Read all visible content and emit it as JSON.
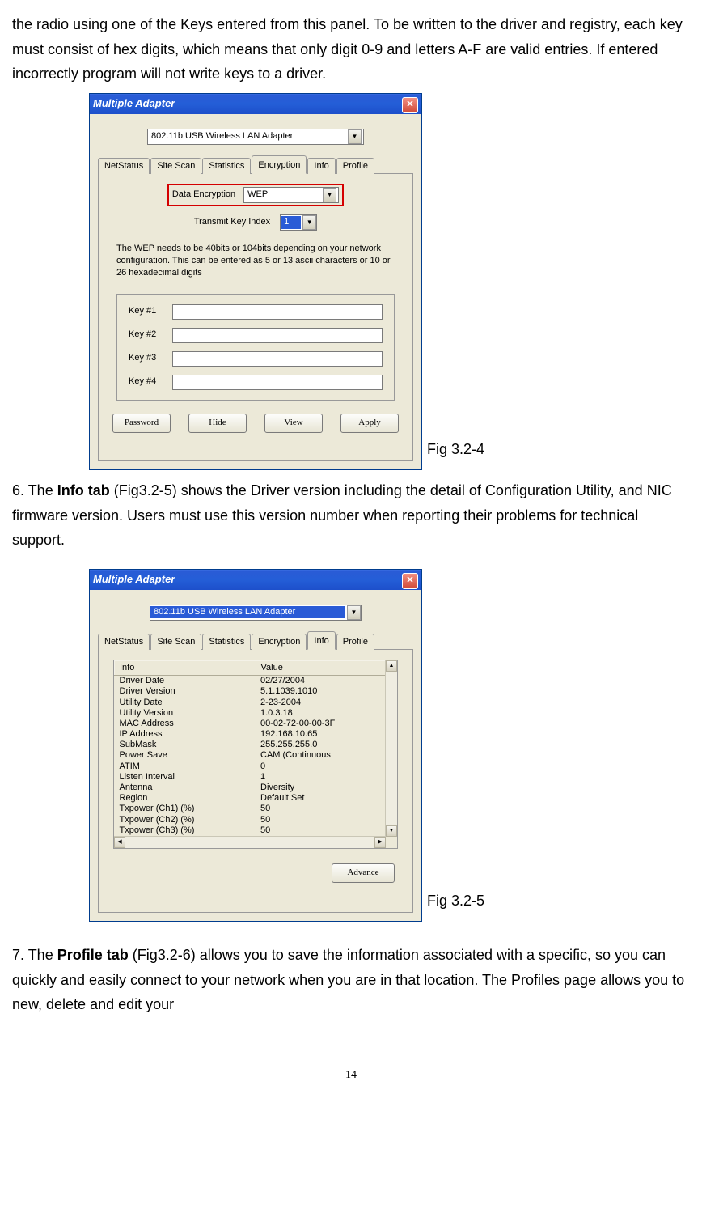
{
  "doc": {
    "para_top": "the radio using one of the Keys entered from this panel. To be written to the driver and registry, each key must consist of hex digits, which means that only digit 0-9 and letters A-F are valid entries. If entered incorrectly program will not write keys to a driver.",
    "fig1_caption": " Fig 3.2-4",
    "para_info_prefix": "6. The ",
    "para_info_bold": "Info tab",
    "para_info_rest": " (Fig3.2-5) shows the Driver version including the detail of Configuration Utility, and NIC firmware version. Users must use this version number when reporting their problems for technical support.",
    "fig2_caption": "Fig 3.2-5",
    "para_profile_prefix": "7. The ",
    "para_profile_bold": "Profile tab",
    "para_profile_rest": " (Fig3.2-6) allows you to save the information associated with a specific, so you can quickly and easily connect to your network when you are in that location. The Profiles page allows you to new, delete and edit your",
    "page_number": "14"
  },
  "dialog_common": {
    "title": "Multiple Adapter",
    "close_glyph": "✕",
    "adapter_text": "802.11b USB Wireless LAN Adapter",
    "tabs": {
      "netstatus": "NetStatus",
      "sitescan": "Site Scan",
      "statistics": "Statistics",
      "encryption": "Encryption",
      "info": "Info",
      "profile": "Profile"
    },
    "combo_arrow": "▼"
  },
  "enc": {
    "data_encryption_label": "Data Encryption",
    "wep_value": "WEP",
    "transmit_key_label": "Transmit Key Index",
    "transmit_key_value": "1",
    "note": "The WEP needs to be 40bits or 104bits depending on your network configuration. This can be entered as 5 or 13 ascii characters or 10 or 26 hexadecimal digits",
    "key1": "Key #1",
    "key2": "Key #2",
    "key3": "Key #3",
    "key4": "Key #4",
    "btn_password": "Password",
    "btn_hide": "Hide",
    "btn_view": "View",
    "btn_apply": "Apply"
  },
  "info": {
    "col_info": "Info",
    "col_value": "Value",
    "rows": [
      {
        "k": "Driver Date",
        "v": "02/27/2004"
      },
      {
        "k": "Driver Version",
        "v": "5.1.1039.1010"
      },
      {
        "k": "Utility Date",
        "v": "2-23-2004"
      },
      {
        "k": "Utility Version",
        "v": "1.0.3.18"
      },
      {
        "k": "MAC Address",
        "v": "00-02-72-00-00-3F"
      },
      {
        "k": "IP Address",
        "v": "192.168.10.65"
      },
      {
        "k": "SubMask",
        "v": "255.255.255.0"
      },
      {
        "k": "Power Save",
        "v": "CAM (Continuous"
      },
      {
        "k": "ATIM",
        "v": "0"
      },
      {
        "k": "Listen Interval",
        "v": "1"
      },
      {
        "k": "Antenna",
        "v": "Diversity"
      },
      {
        "k": "Region",
        "v": "Default Set"
      },
      {
        "k": "Txpower (Ch1) (%)",
        "v": "50"
      },
      {
        "k": "Txpower (Ch2) (%)",
        "v": "50"
      },
      {
        "k": "Txpower (Ch3) (%)",
        "v": "50"
      }
    ],
    "btn_advance": "Advance",
    "sb_up": "▲",
    "sb_down": "▼",
    "sb_left": "◀",
    "sb_right": "▶"
  }
}
